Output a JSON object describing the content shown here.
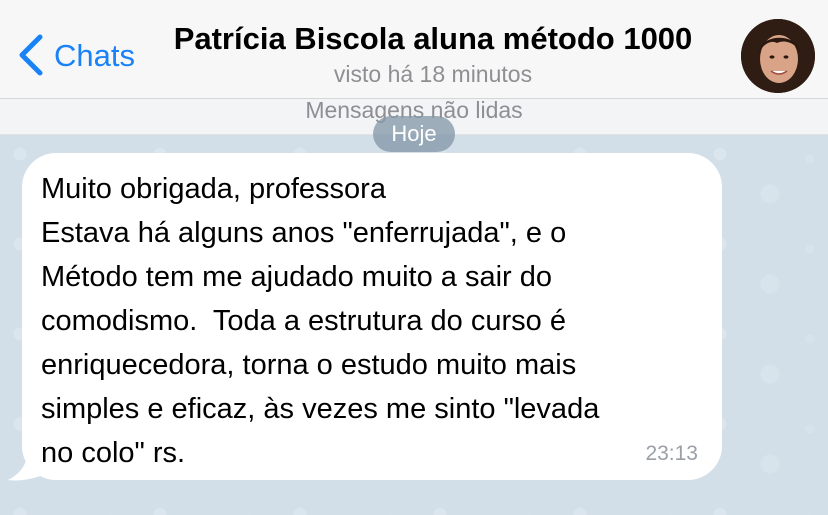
{
  "header": {
    "back_label": "Chats",
    "title": "Patrícia Biscola aluna método 1000",
    "subtitle": "visto há 18 minutos"
  },
  "banner": {
    "unread_label": "Mensagens não lidas"
  },
  "date_separator": "Hoje",
  "messages": [
    {
      "text": "Muito obrigada, professora\nEstava há alguns anos \"enferrujada\", e o\nMétodo tem me ajudado muito a sair do\ncomodismo.  Toda a estrutura do curso é\nenriquecedora, torna o estudo muito mais\nsimples e eficaz, às vezes me sinto \"levada\nno colo\" rs.",
      "time": "23:13",
      "direction": "incoming"
    }
  ],
  "icons": {
    "back": "chevron-left-icon",
    "avatar": "contact-avatar"
  },
  "colors": {
    "accent": "#1a82f7",
    "bubble": "#ffffff",
    "chat_background": "#d2dfe9",
    "secondary_text": "#8e8e93"
  }
}
